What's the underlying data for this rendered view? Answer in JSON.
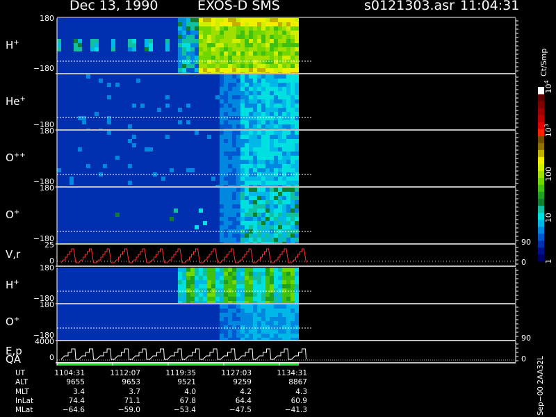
{
  "header": {
    "date": "Dec 13, 1990",
    "title": "EXOS-D SMS",
    "file": "s0121303.asr",
    "time": "11:04:31"
  },
  "panels": [
    {
      "id": "hplus1",
      "label_main": "H",
      "label_sup": "+",
      "tick_top": "180",
      "tick_bottom": "−180",
      "species": "hplus"
    },
    {
      "id": "heplus",
      "label_main": "He",
      "label_sup": "+",
      "tick_top": "",
      "tick_bottom": "−180",
      "species": "heplus"
    },
    {
      "id": "opp",
      "label_main": "O",
      "label_sup": "++",
      "tick_top": "180",
      "tick_bottom": "−180",
      "species": "opp"
    },
    {
      "id": "oplus1",
      "label_main": "O",
      "label_sup": "+",
      "tick_top": "180",
      "tick_bottom": "−180",
      "species": "oplus"
    },
    {
      "id": "vr",
      "label_main": "V,r",
      "label_sup": "",
      "tick_top": "25",
      "tick_bottom": "0",
      "species": "vr"
    },
    {
      "id": "hplus2",
      "label_main": "H",
      "label_sup": "+",
      "tick_top": "180",
      "tick_bottom": "−180",
      "species": "hplus2"
    },
    {
      "id": "oplus2",
      "label_main": "O",
      "label_sup": "+",
      "tick_top": "180",
      "tick_bottom": "−180",
      "species": "oplus2"
    },
    {
      "id": "ep",
      "label_main": "E,p",
      "label_sup": "",
      "tick_top": "4000",
      "tick_bottom": "0",
      "species": "ep"
    }
  ],
  "qa_label": "QA",
  "right_axis": {
    "vr_top": "90",
    "vr_bottom": "0",
    "ep_top": "90",
    "ep_bottom": "0"
  },
  "colorbar": {
    "title": "Ct/Smp",
    "scale": "log",
    "range": [
      1,
      10000
    ],
    "labels": [
      {
        "text": "1",
        "value": 1
      },
      {
        "text": "10",
        "value": 10
      },
      {
        "text": "100",
        "value": 100
      },
      {
        "text": "10",
        "sup": "3",
        "value": 1000
      },
      {
        "text": "10",
        "sup": "4",
        "value": 10000
      }
    ],
    "colors": [
      "#00006a",
      "#00108a",
      "#0030b0",
      "#0058d0",
      "#0088e0",
      "#00b8e8",
      "#00e0e0",
      "#10c0a0",
      "#108030",
      "#20a020",
      "#40c010",
      "#70d800",
      "#a0e000",
      "#d0f000",
      "#f0f000",
      "#c0b000",
      "#907000",
      "#705000",
      "#ff2000",
      "#e00000",
      "#c00000",
      "#a00000",
      "#800000",
      "#600000",
      "#ffffff"
    ]
  },
  "chart_data": {
    "type": "heatmap",
    "title": "EXOS-D SMS",
    "x_axis": "UT",
    "time_ticks": [
      "1104:31",
      "1112:07",
      "1119:35",
      "1127:03",
      "1134:31"
    ],
    "spectrograms": [
      {
        "name": "H+",
        "axis": "pitch angle",
        "ylim": [
          -180,
          180
        ]
      },
      {
        "name": "He+",
        "axis": "pitch angle",
        "ylim": [
          -180,
          180
        ]
      },
      {
        "name": "O++",
        "axis": "pitch angle",
        "ylim": [
          -180,
          180
        ]
      },
      {
        "name": "O+",
        "axis": "pitch angle",
        "ylim": [
          -180,
          180
        ]
      },
      {
        "name": "H+",
        "axis": "pitch angle",
        "ylim": [
          -180,
          180
        ]
      },
      {
        "name": "O+",
        "axis": "pitch angle",
        "ylim": [
          -180,
          180
        ]
      }
    ],
    "line_panels": [
      {
        "name": "V,r",
        "ylim": [
          0,
          25
        ],
        "right_ylim": [
          0,
          90
        ]
      },
      {
        "name": "E,p",
        "ylim": [
          0,
          4000
        ],
        "right_ylim": [
          0,
          90
        ]
      }
    ],
    "colorbar_unit": "Ct/Smp",
    "colorbar_range": [
      1,
      10000
    ]
  },
  "orbit_table": {
    "rows": [
      {
        "label": "UT",
        "values": [
          "1104:31",
          "1112:07",
          "1119:35",
          "1127:03",
          "1134:31"
        ]
      },
      {
        "label": "ALT",
        "values": [
          "9655",
          "9653",
          "9521",
          "9259",
          "8867"
        ]
      },
      {
        "label": "MLT",
        "values": [
          "3.4",
          "3.7",
          "4.0",
          "4.2",
          "4.3"
        ]
      },
      {
        "label": "InLat",
        "values": [
          "74.4",
          "71.1",
          "67.8",
          "64.4",
          "60.9"
        ]
      },
      {
        "label": "MLat",
        "values": [
          "−64.6",
          "−59.0",
          "−53.4",
          "−47.5",
          "−41.3"
        ]
      }
    ]
  },
  "footer_id": "Sep−00 2AA32L"
}
